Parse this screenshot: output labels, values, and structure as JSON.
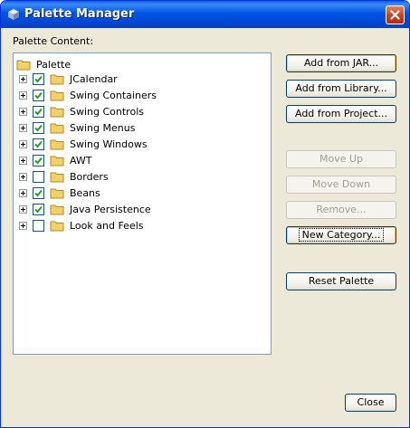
{
  "window": {
    "title": "Palette Manager"
  },
  "palette_label": "Palette Content:",
  "tree": {
    "root": "Palette",
    "items": [
      {
        "label": "JCalendar",
        "checked": true
      },
      {
        "label": "Swing Containers",
        "checked": true
      },
      {
        "label": "Swing Controls",
        "checked": true
      },
      {
        "label": "Swing Menus",
        "checked": true
      },
      {
        "label": "Swing Windows",
        "checked": true
      },
      {
        "label": "AWT",
        "checked": true
      },
      {
        "label": "Borders",
        "checked": false
      },
      {
        "label": "Beans",
        "checked": true
      },
      {
        "label": "Java Persistence",
        "checked": true
      },
      {
        "label": "Look and Feels",
        "checked": false
      }
    ]
  },
  "buttons": {
    "add_jar": "Add from JAR...",
    "add_library": "Add from Library...",
    "add_project": "Add from Project...",
    "move_up": "Move Up",
    "move_down": "Move Down",
    "remove": "Remove...",
    "new_category": "New Category...",
    "reset_palette": "Reset Palette",
    "close": "Close"
  },
  "colors": {
    "title_bar": "#0055e5",
    "folder": "#f2d16b",
    "check": "#21a121",
    "close_button": "#c8401f"
  }
}
